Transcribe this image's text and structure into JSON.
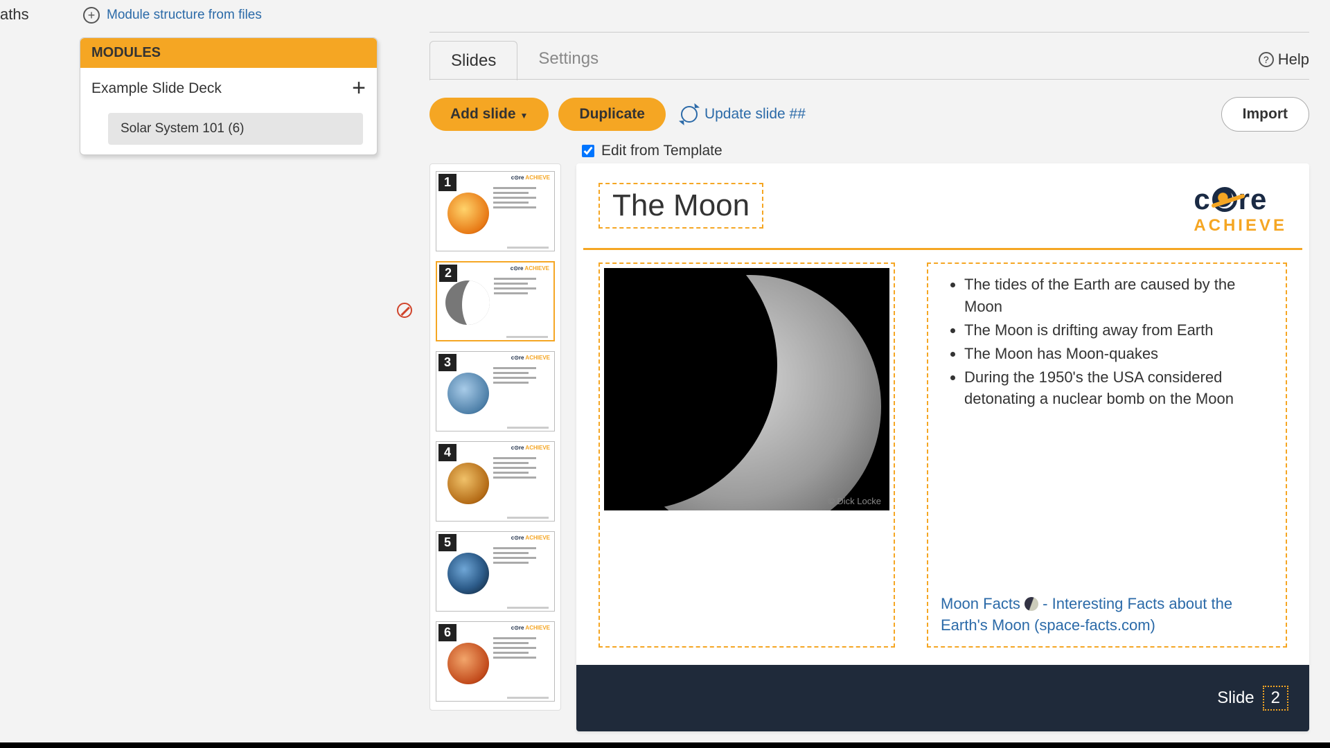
{
  "nav_fragment": "aths",
  "module_link": "Module structure from files",
  "modules": {
    "header": "MODULES",
    "deck_name": "Example Slide Deck",
    "sub_item": "Solar System 101 (6)"
  },
  "tabs": {
    "slides": "Slides",
    "settings": "Settings"
  },
  "help_label": "Help",
  "toolbar": {
    "add_slide": "Add slide",
    "duplicate": "Duplicate",
    "update": "Update slide ##",
    "import": "Import"
  },
  "edit_template": {
    "checked": true,
    "label": "Edit from Template"
  },
  "thumbnails": [
    "1",
    "2",
    "3",
    "4",
    "5",
    "6"
  ],
  "selected_thumb": 2,
  "slide": {
    "title": "The Moon",
    "brand": {
      "core": "c   re",
      "achieve": "ACHIEVE"
    },
    "bullets": [
      "The tides of the Earth are caused by the Moon",
      "The Moon is drifting away from Earth",
      "The Moon has Moon-quakes",
      "During the 1950's the USA considered detonating a nuclear bomb on the Moon"
    ],
    "image_credit": "© Dick Locke",
    "source_pre": "Moon Facts ",
    "source_post": " - Interesting Facts about the Earth's Moon (space-facts.com)",
    "footer_label": "Slide",
    "footer_num": "2"
  }
}
